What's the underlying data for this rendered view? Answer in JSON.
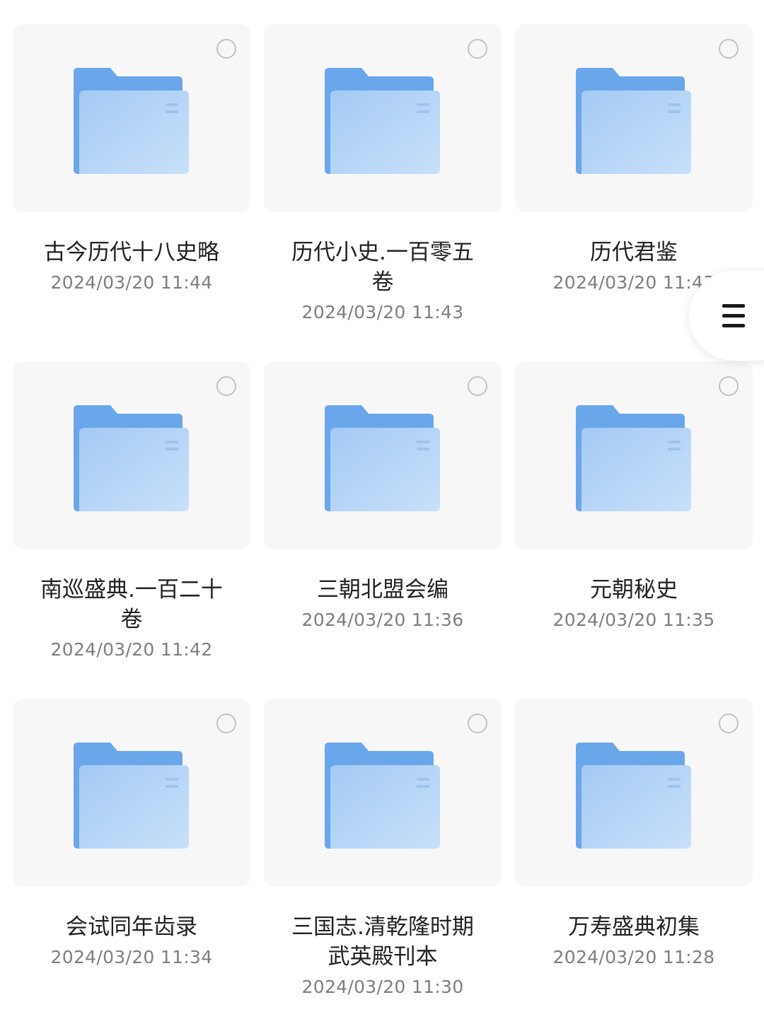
{
  "folders": [
    {
      "name": "古今历代十八史略",
      "date": "2024/03/20 11:44"
    },
    {
      "name": "历代小史.一百零五卷",
      "date": "2024/03/20 11:43"
    },
    {
      "name": "历代君鉴",
      "date": "2024/03/20 11:43"
    },
    {
      "name": "南巡盛典.一百二十卷",
      "date": "2024/03/20 11:42"
    },
    {
      "name": "三朝北盟会编",
      "date": "2024/03/20 11:36"
    },
    {
      "name": "元朝秘史",
      "date": "2024/03/20 11:35"
    },
    {
      "name": "会试同年齿录",
      "date": "2024/03/20 11:34"
    },
    {
      "name": "三国志.清乾隆时期武英殿刊本",
      "date": "2024/03/20 11:30"
    },
    {
      "name": "万寿盛典初集",
      "date": "2024/03/20 11:28"
    }
  ],
  "icons": {
    "folder": "folder-icon",
    "select": "select-circle-icon",
    "menu": "menu-icon"
  },
  "colors": {
    "folder_back": "#6aa7ea",
    "folder_front_top": "#a9cef6",
    "folder_front_bottom": "#c6def9",
    "card_bg": "#f7f7f8"
  }
}
